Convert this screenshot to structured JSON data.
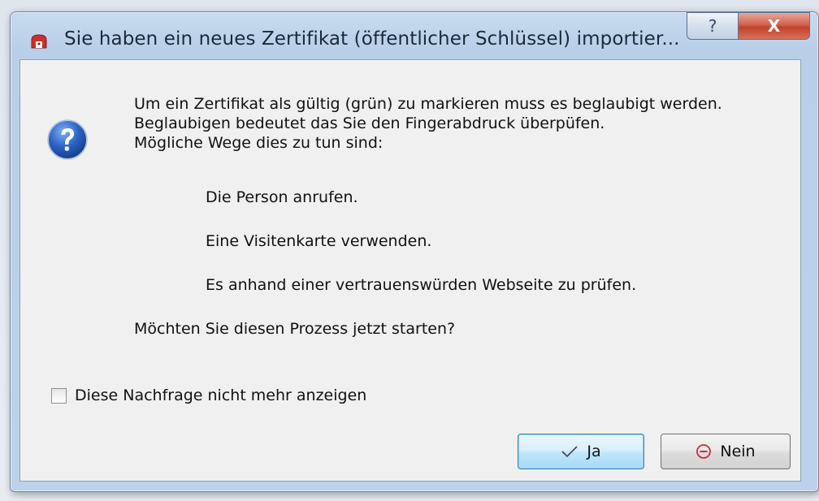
{
  "dialog": {
    "title": "Sie haben ein neues Zertifikat (öffentlicher Schlüssel) importier...",
    "help_caption": "?",
    "close_caption": "X",
    "icon": "question-icon",
    "message_lines": [
      "Um ein Zertifikat als gültig (grün) zu markieren muss es beglaubigt werden.",
      "Beglaubigen bedeutet das Sie den Fingerabdruck überpüfen.",
      "Mögliche Wege dies zu tun sind:"
    ],
    "options": [
      "Die Person anrufen.",
      "Eine Visitenkarte verwenden.",
      "Es anhand einer vertrauenswürden Webseite zu prüfen."
    ],
    "question": "Möchten Sie diesen Prozess jetzt starten?",
    "checkbox_label": "Diese Nachfrage nicht mehr anzeigen",
    "checkbox_checked": false,
    "yes_label": "Ja",
    "no_label": "Nein",
    "colors": {
      "title_bar": "#bcd2ea",
      "close_button": "#c2412b",
      "client_bg": "#f0f0f0",
      "no_icon": "#d0283c"
    }
  }
}
